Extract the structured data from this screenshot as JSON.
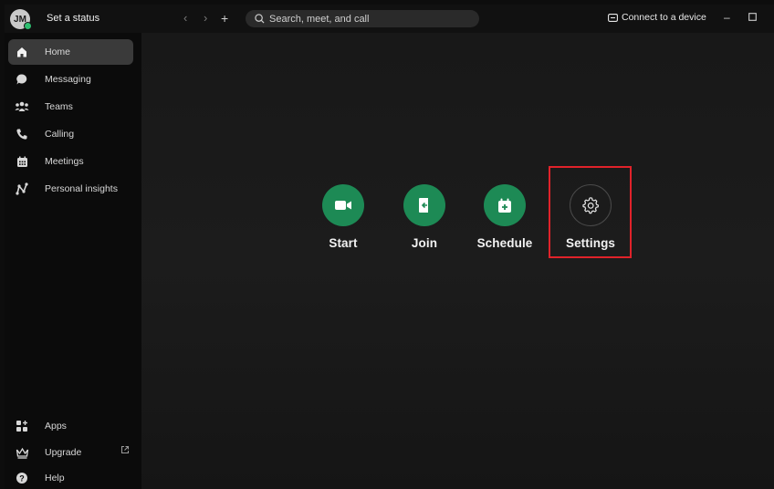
{
  "topbar": {
    "avatar_initials": "JM",
    "status_link": "Set a status",
    "search_placeholder": "Search, meet, and call",
    "connect_label": "Connect to a device"
  },
  "sidebar": {
    "items": [
      {
        "label": "Home",
        "icon": "home-icon",
        "active": true
      },
      {
        "label": "Messaging",
        "icon": "chat-bubble-icon"
      },
      {
        "label": "Teams",
        "icon": "teams-icon"
      },
      {
        "label": "Calling",
        "icon": "phone-icon"
      },
      {
        "label": "Meetings",
        "icon": "calendar-icon"
      },
      {
        "label": "Personal insights",
        "icon": "insights-icon"
      }
    ],
    "bottom_items": [
      {
        "label": "Apps",
        "icon": "apps-icon"
      },
      {
        "label": "Upgrade",
        "icon": "crown-icon"
      },
      {
        "label": "Help",
        "icon": "help-icon"
      }
    ]
  },
  "main": {
    "actions": [
      {
        "label": "Start",
        "icon": "video-camera-icon"
      },
      {
        "label": "Join",
        "icon": "join-door-icon"
      },
      {
        "label": "Schedule",
        "icon": "calendar-plus-icon"
      },
      {
        "label": "Settings",
        "icon": "gear-icon"
      }
    ]
  },
  "colors": {
    "accent_green": "#1d8a55",
    "highlight_red": "#e0222a",
    "presence_green": "#2fbf71"
  }
}
